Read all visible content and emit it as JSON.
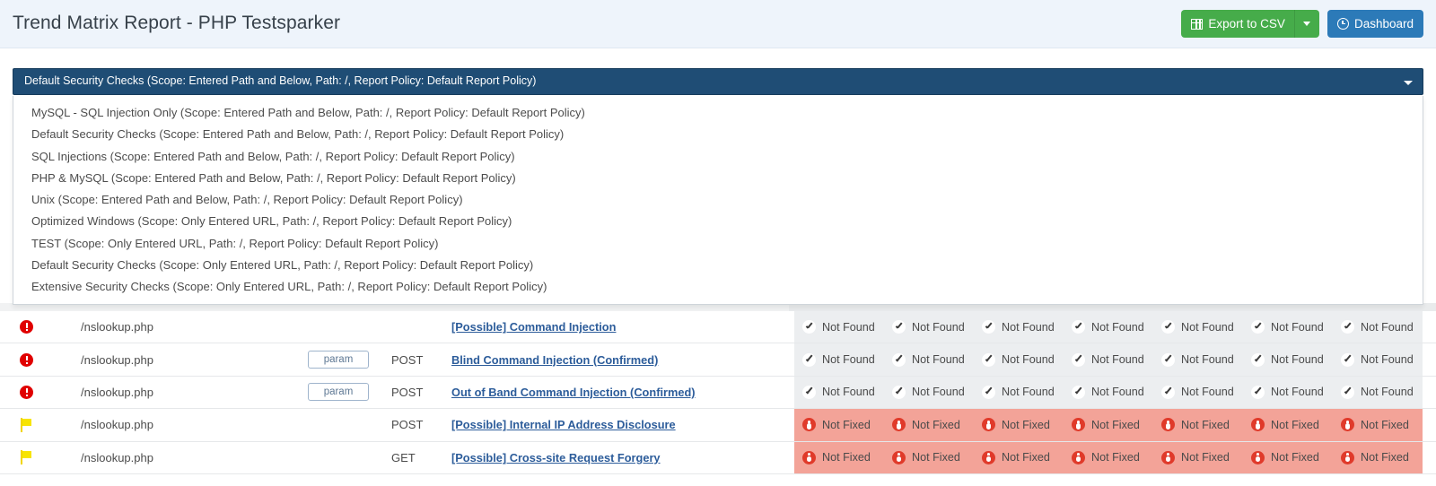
{
  "header": {
    "title": "Trend Matrix Report - PHP Testsparker",
    "export_label": "Export to CSV",
    "export_caret": "caret-down",
    "dashboard_label": "Dashboard"
  },
  "scan_profile_select": {
    "selected": "Default Security Checks (Scope: Entered Path and Below, Path: /, Report Policy: Default Report Policy)",
    "options": [
      "MySQL - SQL Injection Only (Scope: Entered Path and Below, Path: /, Report Policy: Default Report Policy)",
      "Default Security Checks (Scope: Entered Path and Below, Path: /, Report Policy: Default Report Policy)",
      "SQL Injections (Scope: Entered Path and Below, Path: /, Report Policy: Default Report Policy)",
      "PHP & MySQL (Scope: Entered Path and Below, Path: /, Report Policy: Default Report Policy)",
      "Unix (Scope: Entered Path and Below, Path: /, Report Policy: Default Report Policy)",
      "Optimized Windows (Scope: Only Entered URL, Path: /, Report Policy: Default Report Policy)",
      "TEST (Scope: Only Entered URL, Path: /, Report Policy: Default Report Policy)",
      "Default Security Checks (Scope: Only Entered URL, Path: /, Report Policy: Default Report Policy)",
      "Extensive Security Checks (Scope: Only Entered URL, Path: /, Report Policy: Default Report Policy)"
    ]
  },
  "matrix": {
    "rows": [
      {
        "severity_icon": "critical-icon",
        "severity": "critical",
        "path": "/nslookup.php",
        "param": "",
        "method": "",
        "vulnerability": "[Possible] Command Injection",
        "status_label": "Not Found",
        "status_kind": "notfound",
        "status_icon": "check-icon"
      },
      {
        "severity_icon": "critical-icon",
        "severity": "critical",
        "path": "/nslookup.php",
        "param": "param",
        "method": "POST",
        "vulnerability": "Blind Command Injection (Confirmed)",
        "status_label": "Not Found",
        "status_kind": "notfound",
        "status_icon": "check-icon"
      },
      {
        "severity_icon": "critical-icon",
        "severity": "critical",
        "path": "/nslookup.php",
        "param": "param",
        "method": "POST",
        "vulnerability": "Out of Band Command Injection (Confirmed)",
        "status_label": "Not Found",
        "status_kind": "notfound",
        "status_icon": "check-icon"
      },
      {
        "severity_icon": "flag-icon",
        "severity": "low",
        "path": "/nslookup.php",
        "param": "",
        "method": "POST",
        "vulnerability": "[Possible] Internal IP Address Disclosure",
        "status_label": "Not Fixed",
        "status_kind": "notfixed",
        "status_icon": "bug-icon"
      },
      {
        "severity_icon": "flag-icon",
        "severity": "low",
        "path": "/nslookup.php",
        "param": "",
        "method": "GET",
        "vulnerability": "[Possible] Cross-site Request Forgery",
        "status_label": "Not Fixed",
        "status_kind": "notfixed",
        "status_icon": "bug-icon"
      }
    ],
    "status_column_count": 7
  },
  "colors": {
    "header_bg": "#eef4fb",
    "select_bg": "#1f4d75",
    "export_green": "#46ac4a",
    "dashboard_blue": "#2c7ab8",
    "link_blue": "#2c5c9a",
    "notfound_bg": "#eceef0",
    "notfixed_bg": "#f3a398",
    "critical_red": "#e00000",
    "flag_yellow": "#f7e400"
  }
}
